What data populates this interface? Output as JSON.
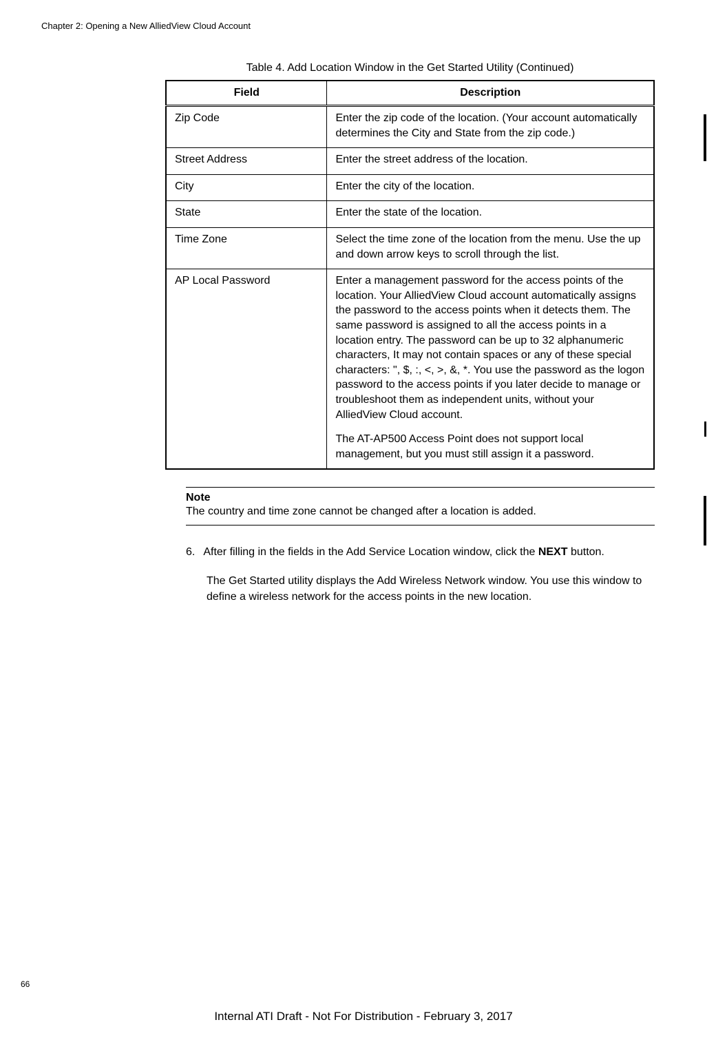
{
  "header": "Chapter 2: Opening a New AlliedView Cloud Account",
  "table": {
    "caption": "Table 4. Add Location Window in the Get Started Utility (Continued)",
    "headers": {
      "field": "Field",
      "description": "Description"
    },
    "rows": [
      {
        "field": "Zip Code",
        "desc": "Enter the zip code of the location. (Your account automatically determines the City and State from the zip code.)"
      },
      {
        "field": "Street Address",
        "desc": "Enter the street address of the location."
      },
      {
        "field": "City",
        "desc": "Enter the city of the location."
      },
      {
        "field": "State",
        "desc": "Enter the state of the location."
      },
      {
        "field": "Time Zone",
        "desc": "Select the time zone of the location from the menu. Use the up and down arrow keys to scroll through the list."
      },
      {
        "field": "AP Local Password",
        "desc": "Enter a management password for the access points of the location. Your AlliedView Cloud account automatically assigns the password to the access points when it detects them. The same password is assigned to all the access points in a location entry. The password can be up to 32 alphanumeric characters, It may not contain spaces or any of these special characters: \", $, :, <, >, &, *. You use the password as the logon password to the access points if you later decide to manage or troubleshoot them as independent units, without your AlliedView Cloud account.",
        "desc2": "The AT-AP500 Access Point does not support local management, but you must still assign it a password."
      }
    ]
  },
  "note": {
    "title": "Note",
    "text": "The country and time zone cannot be changed after a location is added."
  },
  "step": {
    "num": "6.",
    "text_before": "After filling in the fields in the Add Service Location window, click the ",
    "bold": "NEXT",
    "text_after": " button."
  },
  "followup": "The Get Started utility displays the Add Wireless Network window. You use this window to define a wireless network for the access points in the new location.",
  "page_number": "66",
  "footer": "Internal ATI Draft - Not For Distribution - February 3, 2017"
}
